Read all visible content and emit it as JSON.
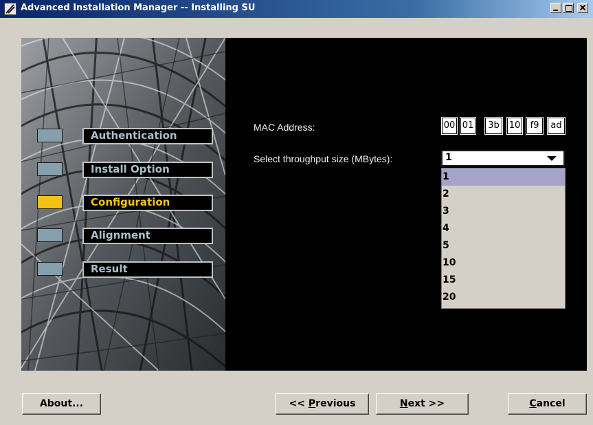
{
  "window": {
    "title": "Advanced Installation Manager -- Installing SU"
  },
  "icons": {
    "app": "installer-app-icon",
    "minimize": "minimize-icon",
    "maximize": "maximize-icon",
    "close": "close-icon",
    "dropdown": "chevron-down-icon"
  },
  "steps": [
    {
      "label": "Authentication",
      "active": false
    },
    {
      "label": "Install Option",
      "active": false
    },
    {
      "label": "Configuration",
      "active": true
    },
    {
      "label": "Alignment",
      "active": false
    },
    {
      "label": "Result",
      "active": false
    }
  ],
  "form": {
    "mac_label": "MAC Address:",
    "mac_octets": [
      "00",
      "01",
      "3b",
      "10",
      "f9",
      "ad"
    ],
    "throughput_label": "Select throughput size (MBytes):",
    "throughput_selected": "1",
    "throughput_options": [
      "1",
      "2",
      "3",
      "4",
      "5",
      "10",
      "15",
      "20"
    ]
  },
  "buttons": {
    "about": "About...",
    "previous_prefix": "<< ",
    "previous_mnemonic": "P",
    "previous_rest": "revious",
    "next_mnemonic": "N",
    "next_rest": "ext >>",
    "cancel_mnemonic": "C",
    "cancel_rest": "ancel"
  },
  "colors": {
    "titlebar": "#0a246a",
    "active_step": "#f2c21b",
    "inactive_step": "#85a0ac",
    "selected_option": "#a5a3c8",
    "panel_background": "#000000"
  }
}
